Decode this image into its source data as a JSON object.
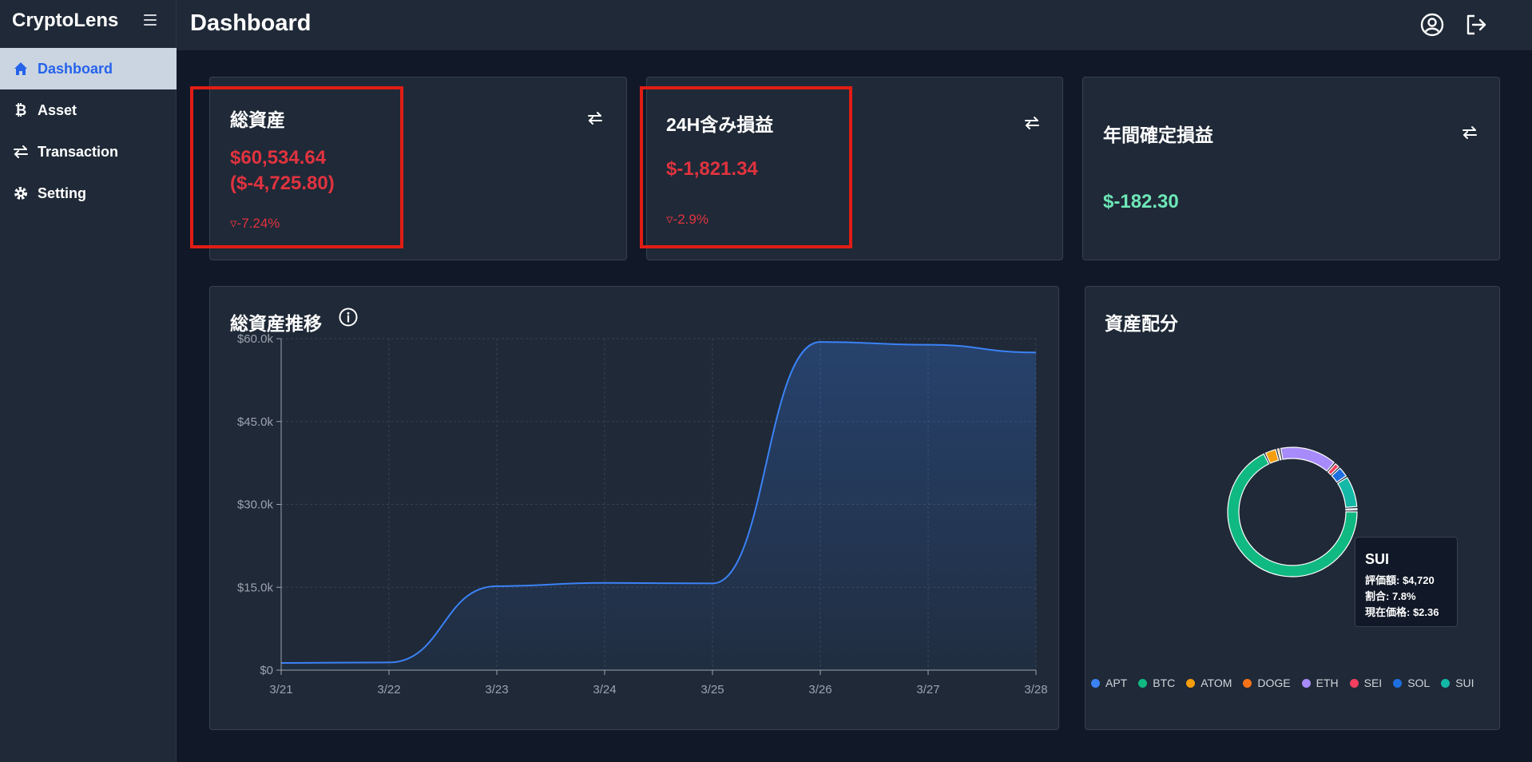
{
  "app": {
    "brand": "CryptoLens",
    "page_title": "Dashboard"
  },
  "sidebar": {
    "items": [
      {
        "label": "Dashboard",
        "icon": "home-icon",
        "active": true
      },
      {
        "label": "Asset",
        "icon": "bitcoin-icon",
        "active": false
      },
      {
        "label": "Transaction",
        "icon": "swap-icon",
        "active": false
      },
      {
        "label": "Setting",
        "icon": "gear-icon",
        "active": false
      }
    ]
  },
  "topbar": {
    "icons": [
      "user-circle-icon",
      "logout-icon"
    ]
  },
  "summary": {
    "total_assets": {
      "title": "総資産",
      "value": "$60,534.64",
      "change": "($-4,725.80)",
      "percent": "▿-7.24%"
    },
    "pnl_24h": {
      "title": "24H含み損益",
      "value": "$-1,821.34",
      "percent": "▿-2.9%"
    },
    "annual_realized": {
      "title": "年間確定損益",
      "value": "$-182.30"
    }
  },
  "history": {
    "title": "総資産推移"
  },
  "allocation": {
    "title": "資産配分",
    "legend": [
      {
        "name": "APT",
        "color": "#3b82f6"
      },
      {
        "name": "BTC",
        "color": "#10b981"
      },
      {
        "name": "ATOM",
        "color": "#f59e0b"
      },
      {
        "name": "DOGE",
        "color": "#f97316"
      },
      {
        "name": "ETH",
        "color": "#a78bfa"
      },
      {
        "name": "SEI",
        "color": "#f43f5e"
      },
      {
        "name": "SOL",
        "color": "#1d6fe0"
      },
      {
        "name": "SUI",
        "color": "#14b8a6"
      }
    ],
    "tooltip": {
      "name": "SUI",
      "value": "評価額: $4,720",
      "share": "割合: 7.8%",
      "price": "現在価格: $2.36"
    }
  },
  "colors": {
    "accent": "#2563eb",
    "negative": "#e0333f",
    "positive": "#6ee7b7",
    "highlight": "#e11d14"
  },
  "chart_data": [
    {
      "type": "area",
      "title": "総資産推移",
      "x": [
        "3/21",
        "3/22",
        "3/23",
        "3/24",
        "3/25",
        "3/26",
        "3/27",
        "3/28"
      ],
      "values": [
        1300,
        1400,
        15200,
        15800,
        15700,
        59400,
        58900,
        57500
      ],
      "y_ticks": [
        "$0",
        "$15.0k",
        "$30.0k",
        "$45.0k",
        "$60.0k"
      ],
      "ylim": [
        0,
        60000
      ],
      "grid": true,
      "color": "#3b82f6"
    },
    {
      "type": "pie",
      "title": "資産配分",
      "labels": [
        "APT",
        "BTC",
        "ATOM",
        "DOGE",
        "ETH",
        "SEI",
        "SOL",
        "SUI"
      ],
      "values": [
        0.8,
        66.0,
        3.0,
        0.8,
        14.0,
        1.5,
        2.8,
        7.8
      ],
      "colors": [
        "#3b82f6",
        "#10b981",
        "#f59e0b",
        "#f97316",
        "#a78bfa",
        "#f43f5e",
        "#1d6fe0",
        "#14b8a6"
      ],
      "legend": "bottom"
    }
  ]
}
